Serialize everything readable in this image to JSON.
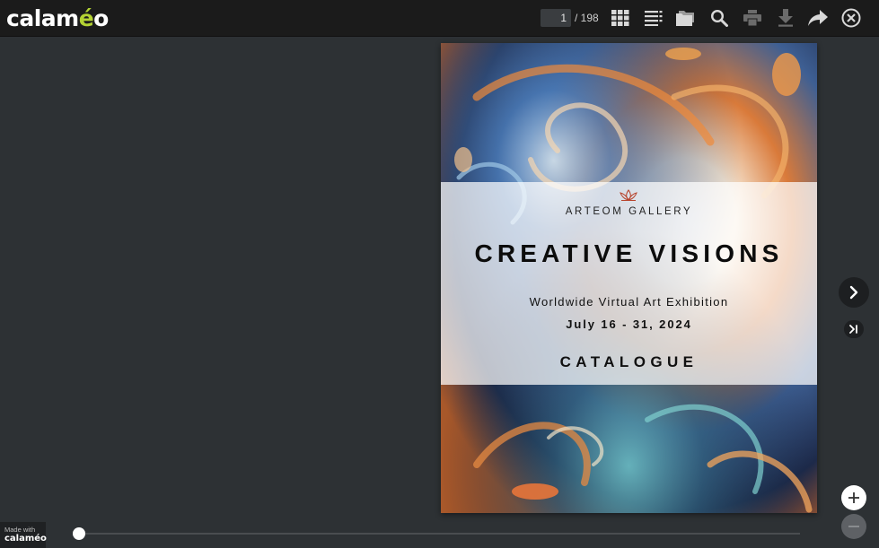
{
  "app": {
    "logo_main": "calam",
    "logo_accent": "é",
    "logo_end": "o"
  },
  "toolbar": {
    "current_page": "1",
    "total_pages": "/ 198",
    "icons": [
      "grid-view-icon",
      "list-view-icon",
      "folder-icon",
      "search-icon",
      "print-icon",
      "download-icon",
      "share-icon",
      "close-icon"
    ]
  },
  "cover": {
    "gallery": "ARTEOM GALLERY",
    "headline": "CREATIVE VISIONS",
    "subline": "Worldwide Virtual Art Exhibition",
    "dates": "July 16 - 31, 2024",
    "catalogue": "CATALOGUE"
  },
  "footer": {
    "made_with": "Made with",
    "brand": "calaméo"
  },
  "slider": {
    "position": 0.0
  },
  "colors": {
    "topbar": "#1b1b1b",
    "background": "#2d3134",
    "logo_accent": "#b3d233"
  }
}
